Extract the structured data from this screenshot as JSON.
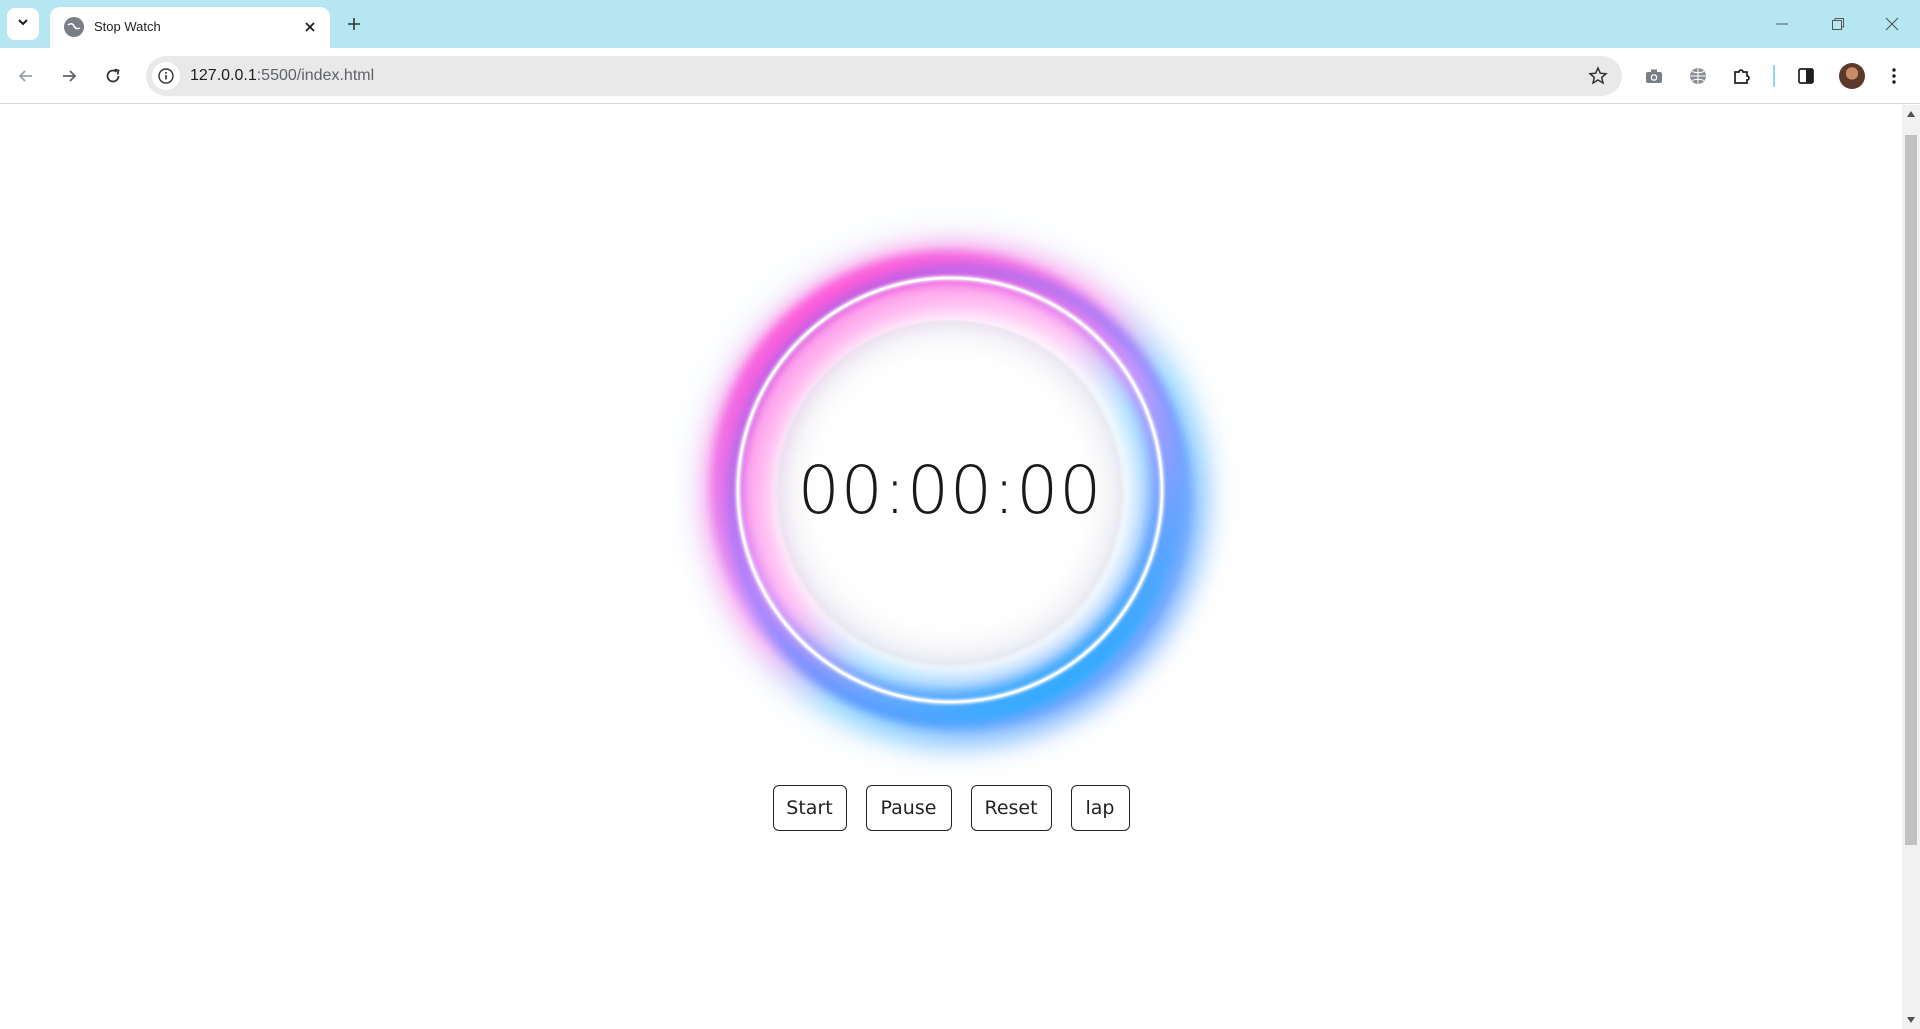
{
  "browser": {
    "tab": {
      "title": "Stop Watch"
    },
    "address": {
      "host": "127.0.0.1",
      "path": ":5500/index.html"
    },
    "accent_color": "#b5e6f2"
  },
  "stopwatch": {
    "time": "00:00:00",
    "buttons": {
      "start": "Start",
      "pause": "Pause",
      "reset": "Reset",
      "lap": "lap"
    },
    "ring_colors": [
      "#ff4fd8",
      "#22c7ff",
      "#1e6bff"
    ]
  },
  "icons": [
    "chevron-down-icon",
    "globe-icon",
    "close-icon",
    "plus-icon",
    "minimize-icon",
    "restore-icon",
    "back-arrow-icon",
    "forward-arrow-icon",
    "reload-icon",
    "info-icon",
    "star-icon",
    "camera-icon",
    "translate-icon",
    "extensions-icon",
    "side-panel-icon"
  ]
}
